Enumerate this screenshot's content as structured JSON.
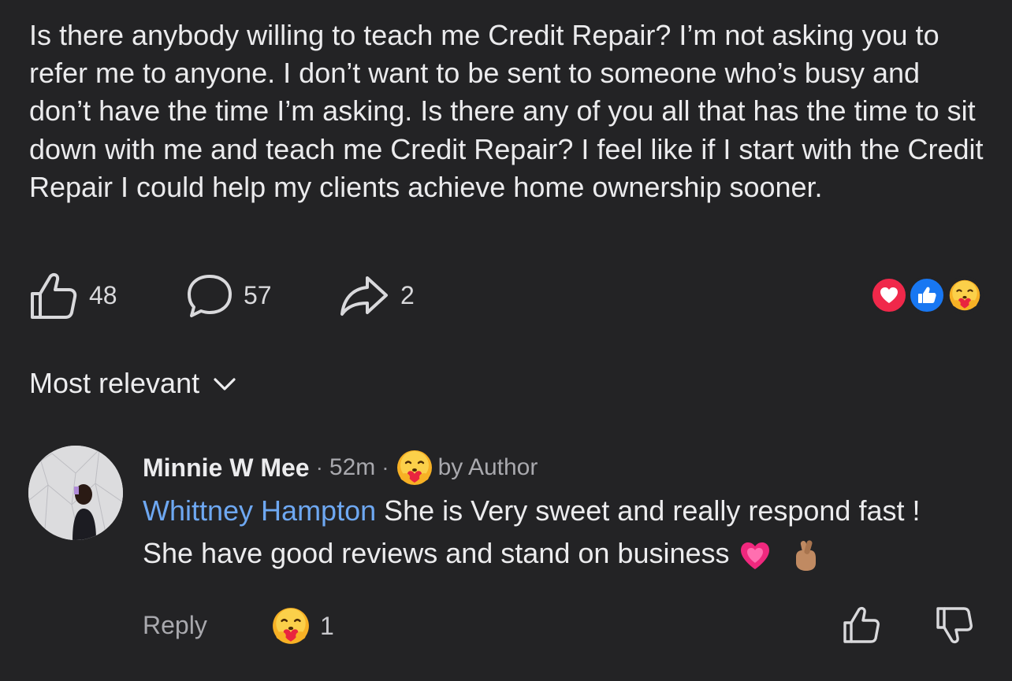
{
  "post": {
    "text": "Is there anybody willing to teach me Credit Repair? I’m not asking you to refer me to anyone. I don’t want to be sent to someone who’s busy and don’t have the time I’m asking. Is there any of you all that has the time to sit down with me and teach me Credit Repair? I feel like if I start with the Credit Repair I could help my clients achieve home ownership sooner.",
    "like_count": "48",
    "comment_count": "57",
    "share_count": "2",
    "reaction_icons": [
      "heart-reaction-icon",
      "like-reaction-icon",
      "care-reaction-icon"
    ]
  },
  "sort": {
    "label": "Most relevant"
  },
  "comment": {
    "author": "Minnie W Mee",
    "separator": "·",
    "time": "52m",
    "author_reaction_label": "by Author",
    "mention": "Whittney Hampton",
    "text": " She is Very sweet and really respond fast ! She have good reviews and stand on business ",
    "reply_label": "Reply",
    "reaction_count": "1",
    "trailing_emojis": [
      "growing-heart-emoji",
      "crossed-fingers-emoji"
    ]
  },
  "colors": {
    "background": "#232325",
    "text": "#ececee",
    "muted": "#a9a9ae",
    "mention": "#6ea8f2",
    "heart_reaction": "#f0284a",
    "like_reaction": "#1877f2",
    "care_reaction": "#f7b125"
  }
}
